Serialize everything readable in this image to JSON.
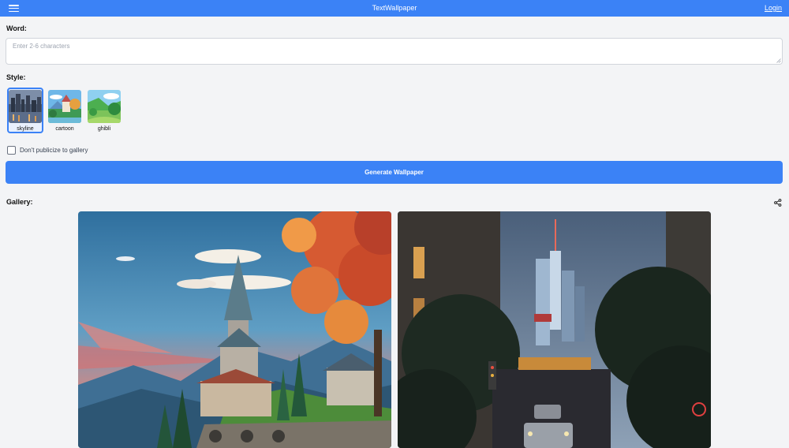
{
  "header": {
    "title": "TextWallpaper",
    "login_label": "Login"
  },
  "word": {
    "label": "Word:",
    "placeholder": "Enter 2-6 characters",
    "value": ""
  },
  "style": {
    "label": "Style:",
    "selected": "skyline",
    "options": [
      {
        "name": "skyline"
      },
      {
        "name": "cartoon"
      },
      {
        "name": "ghibli"
      }
    ]
  },
  "private_option": {
    "label": "Don't publicize to gallery",
    "checked": false
  },
  "generate_label": "Generate Wallpaper",
  "gallery": {
    "label": "Gallery:",
    "share_icon": "share-icon",
    "items": [
      {
        "subject": "church-castle-mountain-autumn-tree"
      },
      {
        "subject": "city-street-night-tower"
      }
    ]
  },
  "colors": {
    "accent": "#3b82f6",
    "background": "#f3f4f6"
  }
}
